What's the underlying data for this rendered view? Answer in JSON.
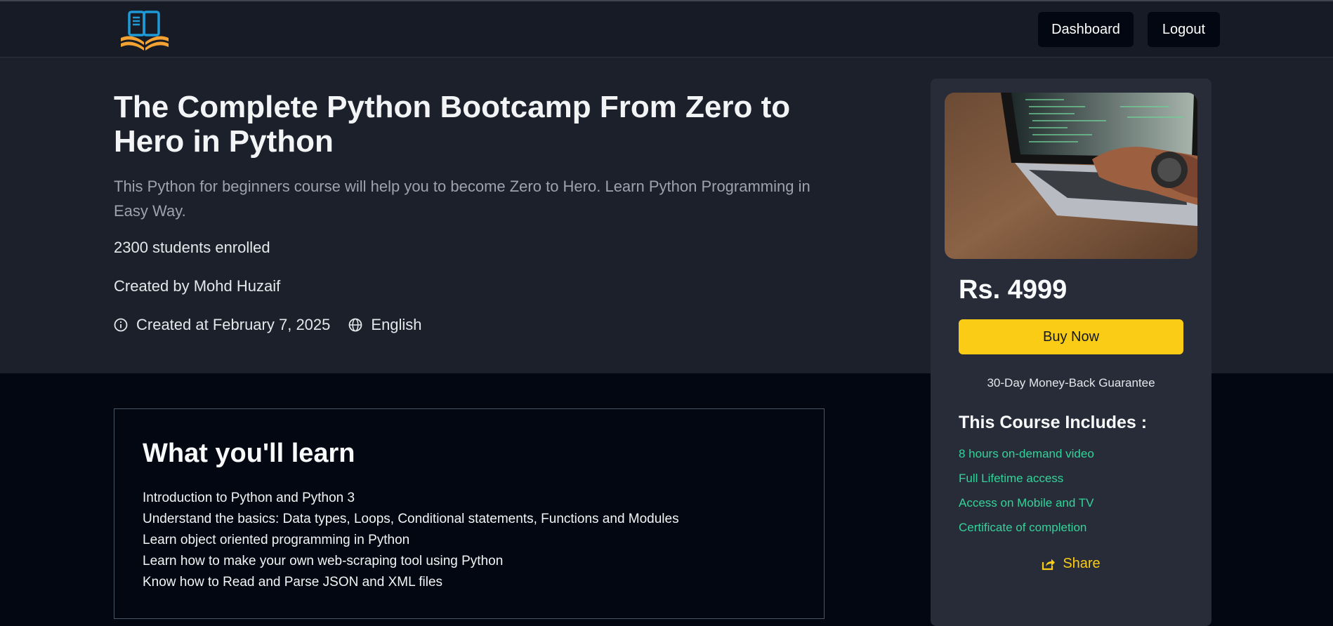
{
  "colors": {
    "page_bg": "#030712",
    "navbar_bg": "#161b26",
    "hero_bg": "#1b202b",
    "sidebar_bg": "#272c38",
    "accent_yellow": "#facc15",
    "includes_green": "#34d399",
    "logo_blue": "#1e9bd7",
    "logo_orange": "#f4a332"
  },
  "navbar": {
    "logo_icon": "open-book-icon",
    "dashboard_label": "Dashboard",
    "logout_label": "Logout"
  },
  "course": {
    "title": "The Complete Python Bootcamp From Zero to Hero in Python",
    "description": "This Python for beginners course will help you to become Zero to Hero. Learn Python Programming in Easy Way.",
    "enrolled": "2300 students enrolled",
    "creator": "Created by Mohd Huzaif",
    "created_at": "Created at February 7, 2025",
    "created_icon": "info-icon",
    "language": "English",
    "language_icon": "globe-icon"
  },
  "learn": {
    "heading": "What you'll learn",
    "items": [
      "Introduction to Python and Python 3",
      "Understand the basics: Data types, Loops, Conditional statements, Functions and Modules",
      "Learn object oriented programming in Python",
      "Learn how to make your own web-scraping tool using Python",
      "Know how to Read and Parse JSON and XML files"
    ]
  },
  "sidebar": {
    "thumbnail_icon": "laptop-typing-photo",
    "price": "Rs. 4999",
    "buy_label": "Buy Now",
    "guarantee": "30-Day Money-Back Guarantee",
    "includes_heading": "This Course Includes :",
    "includes": [
      "8 hours on-demand video",
      "Full Lifetime access",
      "Access on Mobile and TV",
      "Certificate of completion"
    ],
    "share_label": "Share",
    "share_icon": "share-icon"
  }
}
